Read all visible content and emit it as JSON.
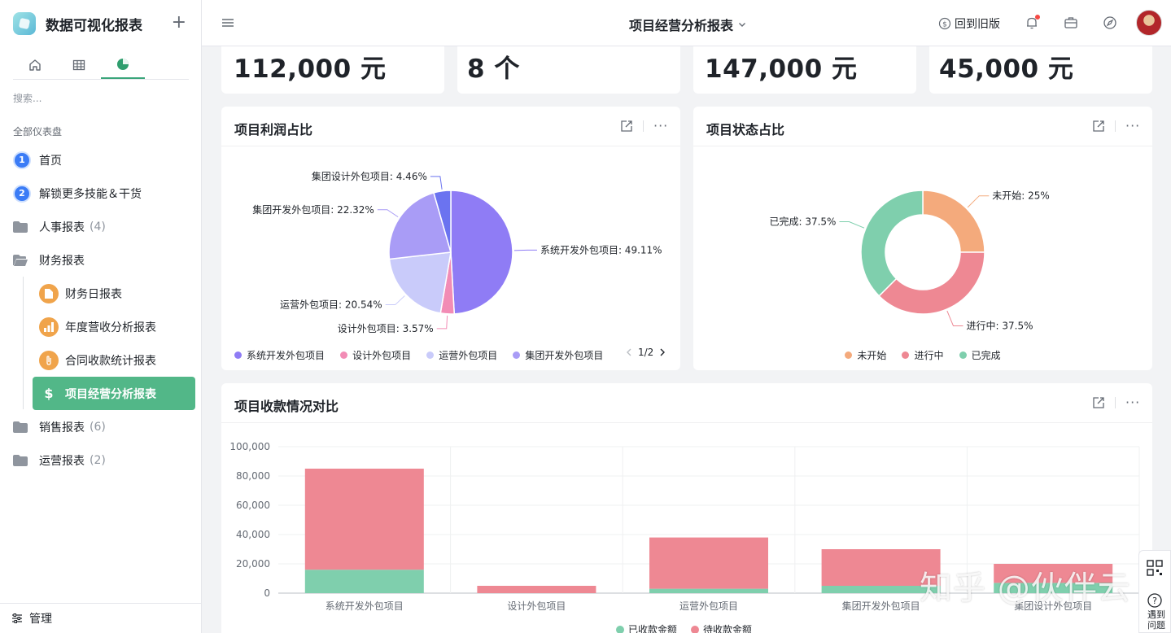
{
  "sidebar": {
    "brand_title": "数据可视化报表",
    "search_placeholder": "搜索...",
    "group_title": "全部仪表盘",
    "items": [
      {
        "label": "首页",
        "badge": "1"
      },
      {
        "label": "解锁更多技能＆干货",
        "badge": "2"
      },
      {
        "label": "人事报表",
        "count": "(4)"
      },
      {
        "label": "财务报表"
      },
      {
        "label": "财务日报表"
      },
      {
        "label": "年度营收分析报表"
      },
      {
        "label": "合同收款统计报表"
      },
      {
        "label": "项目经营分析报表",
        "icon_glyph": "$"
      },
      {
        "label": "销售报表",
        "count": "(6)"
      },
      {
        "label": "运营报表",
        "count": "(2)"
      }
    ],
    "footer_label": "管理"
  },
  "header": {
    "title": "项目经营分析报表",
    "back_label": "回到旧版"
  },
  "kpis": [
    "112,000 元",
    "8 个",
    "147,000 元",
    "45,000 元"
  ],
  "colors": {
    "accent": "#52b788",
    "series_purple": "#8f7cf5",
    "series_pink": "#f28cb5",
    "series_lavender": "#c9cbfa",
    "series_violet": "#a99cf6",
    "series_blue": "#6b73f0",
    "status_orange": "#f4aa7c",
    "status_red": "#ee8893",
    "status_green": "#7fcfad"
  },
  "profit_card": {
    "title": "项目利润占比",
    "pager": "1/2"
  },
  "status_card": {
    "title": "项目状态占比"
  },
  "bar_card": {
    "title": "项目收款情况对比"
  },
  "float_help": "遇到问题",
  "watermark": "知乎 @伙伴云",
  "chart_data": [
    {
      "type": "pie",
      "title": "项目利润占比",
      "categories": [
        "系统开发外包项目",
        "设计外包项目",
        "运营外包项目",
        "集团开发外包项目",
        "集团设计外包项目"
      ],
      "values": [
        49.11,
        3.57,
        20.54,
        22.32,
        4.46
      ],
      "labels": [
        "系统开发外包项目: 49.11%",
        "设计外包项目: 3.57%",
        "运营外包项目: 20.54%",
        "集团开发外包项目: 22.32%",
        "集团设计外包项目: 4.46%"
      ],
      "colors": [
        "#8f7cf5",
        "#f28cb5",
        "#c9cbfa",
        "#a99cf6",
        "#6b73f0"
      ],
      "legend_visible": [
        "系统开发外包项目",
        "设计外包项目",
        "运营外包项目",
        "集团开发外包项目"
      ],
      "legend": "bottom"
    },
    {
      "type": "pie",
      "variant": "donut",
      "title": "项目状态占比",
      "categories": [
        "未开始",
        "进行中",
        "已完成"
      ],
      "values": [
        25,
        37.5,
        37.5
      ],
      "labels": [
        "未开始: 25%",
        "进行中: 37.5%",
        "已完成: 37.5%"
      ],
      "colors": [
        "#f4aa7c",
        "#ee8893",
        "#7fcfad"
      ],
      "legend": "bottom"
    },
    {
      "type": "bar",
      "stacked": true,
      "title": "项目收款情况对比",
      "categories": [
        "系统开发外包项目",
        "设计外包项目",
        "运营外包项目",
        "集团开发外包项目",
        "集团设计外包项目"
      ],
      "series": [
        {
          "name": "已收款金额",
          "values": [
            16000,
            0,
            3000,
            5000,
            7000
          ],
          "color": "#7fcfad"
        },
        {
          "name": "待收款金额",
          "values": [
            69000,
            5000,
            35000,
            25000,
            13000
          ],
          "color": "#ee8893"
        }
      ],
      "yticks": [
        "0",
        "20,000",
        "40,000",
        "60,000",
        "80,000",
        "100,000"
      ],
      "ylim": [
        0,
        100000
      ],
      "grid": true,
      "legend": "bottom"
    }
  ]
}
